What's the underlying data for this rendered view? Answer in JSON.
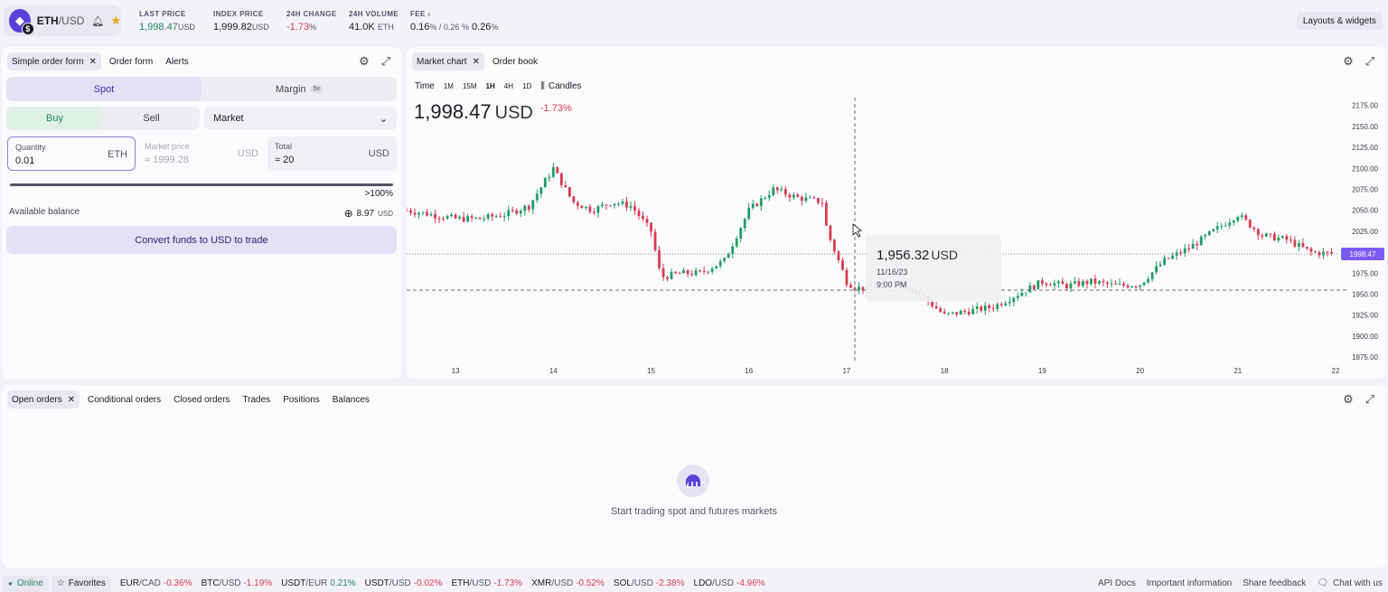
{
  "header": {
    "pair_base": "ETH",
    "pair_quote": "/USD",
    "stats": [
      {
        "label": "LAST PRICE",
        "value": "1,998.47",
        "unit": "USD",
        "color": "#1f8a5b"
      },
      {
        "label": "INDEX PRICE",
        "value": "1,999.82",
        "unit": "USD",
        "color": "#1b1b22"
      },
      {
        "label": "24H CHANGE",
        "value": "-1.73",
        "unit": "%",
        "color": "#d63c50"
      },
      {
        "label": "24H VOLUME",
        "value": "41.0K",
        "unit": "ETH",
        "color": "#1b1b22"
      },
      {
        "label": "FEE",
        "value": "0.16",
        "unit": "% / 0.26 %",
        "color": "#1b1b22"
      }
    ],
    "layouts_label": "Layouts & widgets"
  },
  "order_panel": {
    "tabs": [
      {
        "label": "Simple order form",
        "closable": true
      },
      {
        "label": "Order form",
        "closable": false
      },
      {
        "label": "Alerts",
        "closable": false
      }
    ],
    "spot_label": "Spot",
    "margin_label": "Margin",
    "margin_badge": "5x",
    "buy_label": "Buy",
    "sell_label": "Sell",
    "order_type": "Market",
    "quantity_label": "Quantity",
    "quantity_value": "0.01",
    "quantity_unit": "ETH",
    "market_price_label": "Market price",
    "market_price_value": "≈ 1999.28",
    "market_price_unit": "USD",
    "total_label": "Total",
    "total_value": "≈ 20",
    "total_unit": "USD",
    "slider_label": ">100%",
    "slider_fraction": 1.0,
    "balance_label": "Available balance",
    "balance_value": "8.97",
    "balance_unit": "USD",
    "convert_label": "Convert funds to USD to trade"
  },
  "chart_panel": {
    "tabs": [
      {
        "label": "Market chart",
        "closable": true
      },
      {
        "label": "Order book",
        "closable": false
      }
    ],
    "time_label": "Time",
    "intervals": [
      "1M",
      "15M",
      "1H",
      "4H",
      "1D"
    ],
    "selected_interval": "1H",
    "candles_label": "Candles",
    "price": "1,998.47",
    "price_unit": "USD",
    "change": "-1.73",
    "change_unit": "%",
    "tooltip": {
      "price": "1,956.32",
      "unit": "USD",
      "date": "11/16/23",
      "time": "9:00 PM"
    },
    "last_price_tag": "1998.47",
    "colors": {
      "up": "#1f9e63",
      "down": "#d63c50",
      "accent": "#7b5cf0"
    }
  },
  "chart_data": {
    "type": "line",
    "title": "",
    "xlabel": "",
    "ylabel": "",
    "x_ticks": [
      "13",
      "14",
      "15",
      "16",
      "17",
      "18",
      "19",
      "20",
      "21",
      "22"
    ],
    "y_ticks": [
      "2175.00",
      "2150.00",
      "2125.00",
      "2100.00",
      "2075.00",
      "2050.00",
      "2025.00",
      "2000.00",
      "1975.00",
      "1950.00",
      "1925.00",
      "1900.00",
      "1875.00"
    ],
    "ylim": [
      1873,
      2180
    ],
    "series": [
      {
        "name": "",
        "x": [
          12.5,
          12.75,
          13.0,
          13.25,
          13.5,
          13.75,
          14.0,
          14.2,
          14.4,
          14.6,
          14.8,
          15.0,
          15.1,
          15.3,
          15.5,
          15.75,
          16.0,
          16.25,
          16.5,
          16.75,
          16.8,
          17.0,
          17.1,
          17.3,
          17.5,
          17.75,
          18.0,
          18.25,
          18.5,
          18.75,
          19.0,
          19.25,
          19.5,
          19.75,
          20.0,
          20.25,
          20.5,
          20.75,
          21.0,
          21.25,
          21.5,
          21.75,
          22.0
        ],
        "values": [
          2050,
          2045,
          2040,
          2040,
          2045,
          2055,
          2100,
          2060,
          2050,
          2060,
          2055,
          2025,
          1970,
          1975,
          1975,
          1990,
          2050,
          2075,
          2065,
          2060,
          2025,
          1965,
          1957,
          1960,
          1965,
          1950,
          1925,
          1930,
          1935,
          1950,
          1965,
          1960,
          1965,
          1960,
          1962,
          1990,
          2005,
          2025,
          2045,
          2020,
          2015,
          2000,
          1998
        ]
      }
    ],
    "grid": false,
    "legend": "none"
  },
  "orders_panel": {
    "tabs": [
      {
        "label": "Open orders",
        "closable": true
      },
      {
        "label": "Conditional orders",
        "closable": false
      },
      {
        "label": "Closed orders",
        "closable": false
      },
      {
        "label": "Trades",
        "closable": false
      },
      {
        "label": "Positions",
        "closable": false
      },
      {
        "label": "Balances",
        "closable": false
      }
    ],
    "empty_message": "Start trading spot and futures markets"
  },
  "footer": {
    "online_label": "Online",
    "favorites_label": "Favorites",
    "tickers": [
      {
        "pair": "EUR",
        "quote": "/CAD",
        "change": "-0.36",
        "color": "#d63c50"
      },
      {
        "pair": "BTC",
        "quote": "/USD",
        "change": "-1.19",
        "color": "#d63c50"
      },
      {
        "pair": "USDT",
        "quote": "/EUR",
        "change": "0.21",
        "color": "#1f8a5b"
      },
      {
        "pair": "USDT",
        "quote": "/USD",
        "change": "-0.02",
        "color": "#d63c50"
      },
      {
        "pair": "ETH",
        "quote": "/USD",
        "change": "-1.73",
        "color": "#d63c50"
      },
      {
        "pair": "XMR",
        "quote": "/USD",
        "change": "-0.52",
        "color": "#d63c50"
      },
      {
        "pair": "SOL",
        "quote": "/USD",
        "change": "-2.38",
        "color": "#d63c50"
      },
      {
        "pair": "LDO",
        "quote": "/USD",
        "change": "-4.96",
        "color": "#d63c50"
      }
    ],
    "pct": "%",
    "links": [
      "API Docs",
      "Important information",
      "Share feedback"
    ],
    "chat_label": "Chat with us"
  }
}
